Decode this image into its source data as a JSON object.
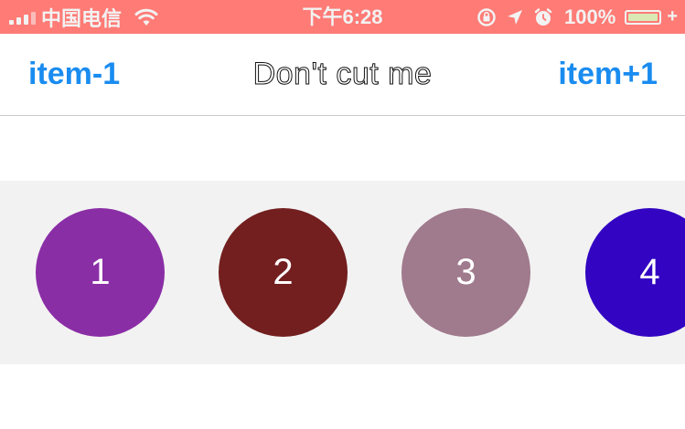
{
  "status_bar": {
    "carrier": "中国电信",
    "time": "下午6:28",
    "battery_percent": "100%",
    "battery_level": 1.0,
    "charging_symbol": "+",
    "icons": [
      "signal-icon",
      "wifi-icon",
      "lock-rotation-icon",
      "location-icon",
      "alarm-icon",
      "battery-icon"
    ]
  },
  "nav": {
    "left_label": "item-1",
    "title": "Don't cut me",
    "right_label": "item+1",
    "tint_color": "#1a8cf0"
  },
  "items": [
    {
      "label": "1",
      "color": "#8a2ea6"
    },
    {
      "label": "2",
      "color": "#731f1f"
    },
    {
      "label": "3",
      "color": "#a07a8d"
    },
    {
      "label": "4",
      "color": "#3305c2"
    }
  ],
  "colors": {
    "status_bar": "#ff7b76",
    "strip_background": "#f2f2f2"
  }
}
